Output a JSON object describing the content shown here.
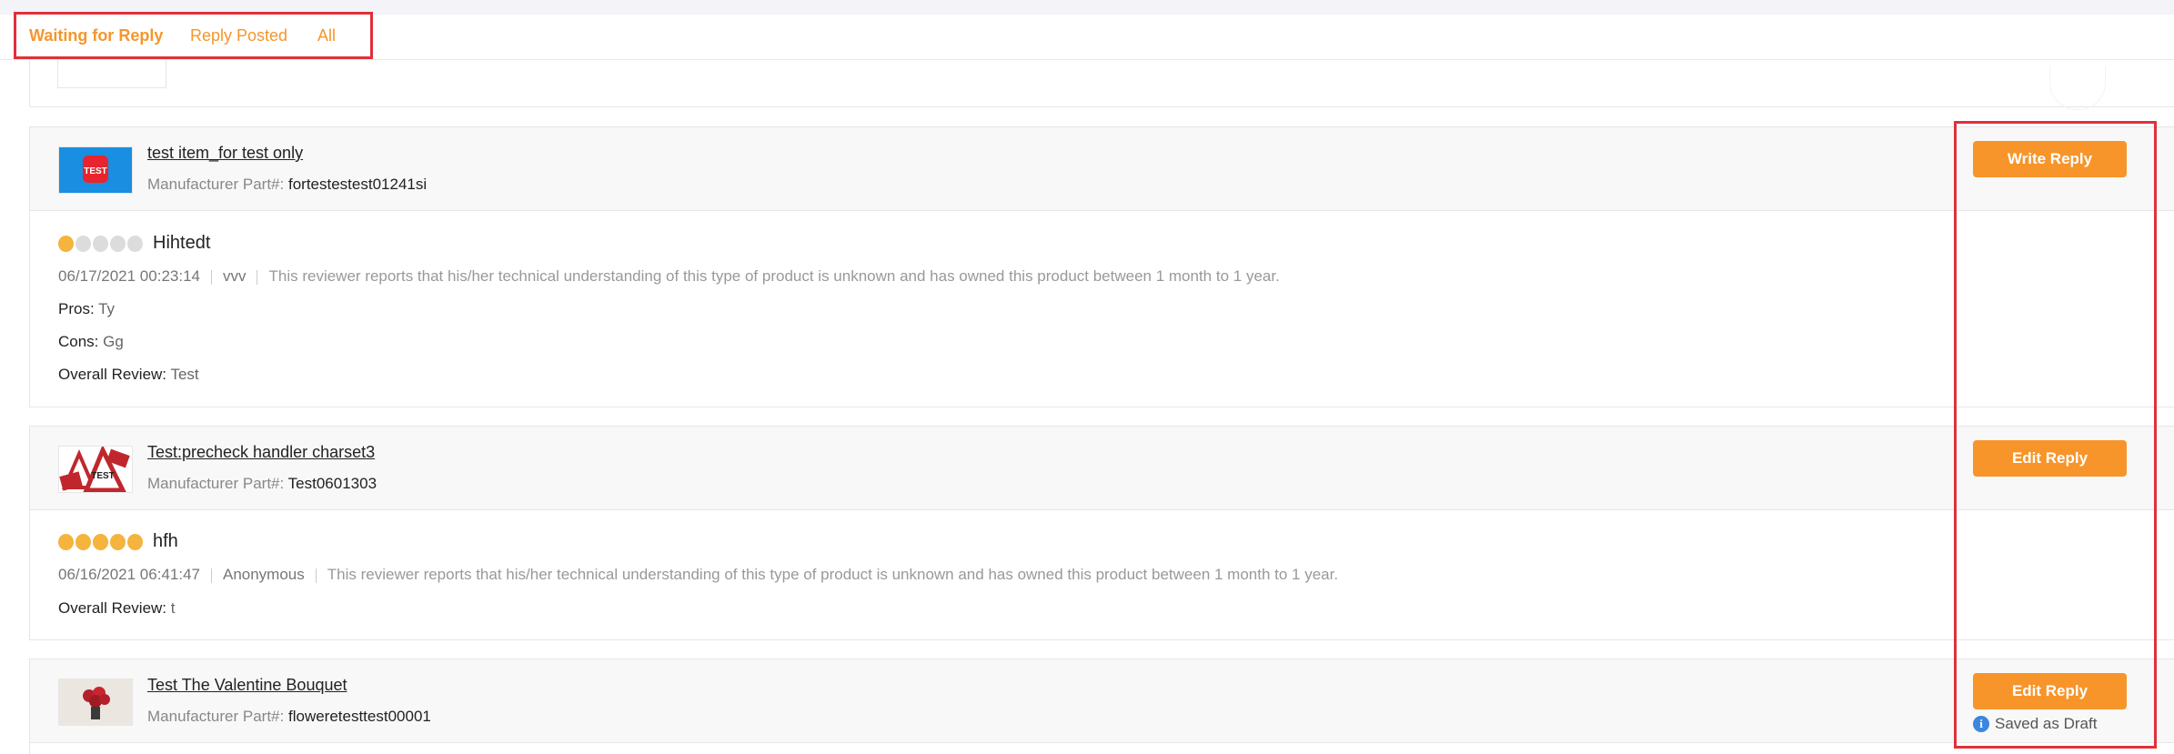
{
  "tabs": [
    {
      "label": "Waiting for Reply",
      "active": true
    },
    {
      "label": "Reply Posted",
      "active": false
    },
    {
      "label": "All",
      "active": false
    }
  ],
  "colors": {
    "accent": "#f7952a",
    "highlight_box": "#e0303a",
    "star_filled": "#f4b43d",
    "star_empty": "#dcdcdc",
    "info": "#3a86e0"
  },
  "reviews": [
    {
      "product_name": "test item_for test only",
      "mpn_label": "Manufacturer Part#:",
      "mpn": "fortestestest01241si",
      "thumb_text": "TEST",
      "rating": 1,
      "title": "Hihtedt",
      "date": "06/17/2021 00:23:14",
      "reviewer": "vvv",
      "reviewer_note": "This reviewer reports that his/her technical understanding of this type of product is unknown and has owned this product between 1 month to 1 year.",
      "pros_label": "Pros:",
      "pros": "Ty",
      "cons_label": "Cons:",
      "cons": "Gg",
      "overall_label": "Overall Review:",
      "overall": "Test",
      "button_label": "Write Reply"
    },
    {
      "product_name": "Test:precheck handler charset3",
      "mpn_label": "Manufacturer Part#:",
      "mpn": "Test0601303",
      "thumb_text": "TEST",
      "rating": 5,
      "title": "hfh",
      "date": "06/16/2021 06:41:47",
      "reviewer": "Anonymous",
      "reviewer_note": "This reviewer reports that his/her technical understanding of this type of product is unknown and has owned this product between 1 month to 1 year.",
      "overall_label": "Overall Review:",
      "overall": "t",
      "button_label": "Edit Reply"
    },
    {
      "product_name": "Test The Valentine Bouquet",
      "mpn_label": "Manufacturer Part#:",
      "mpn": "floweretesttest00001",
      "button_label": "Edit Reply",
      "status": "Saved as Draft"
    }
  ]
}
